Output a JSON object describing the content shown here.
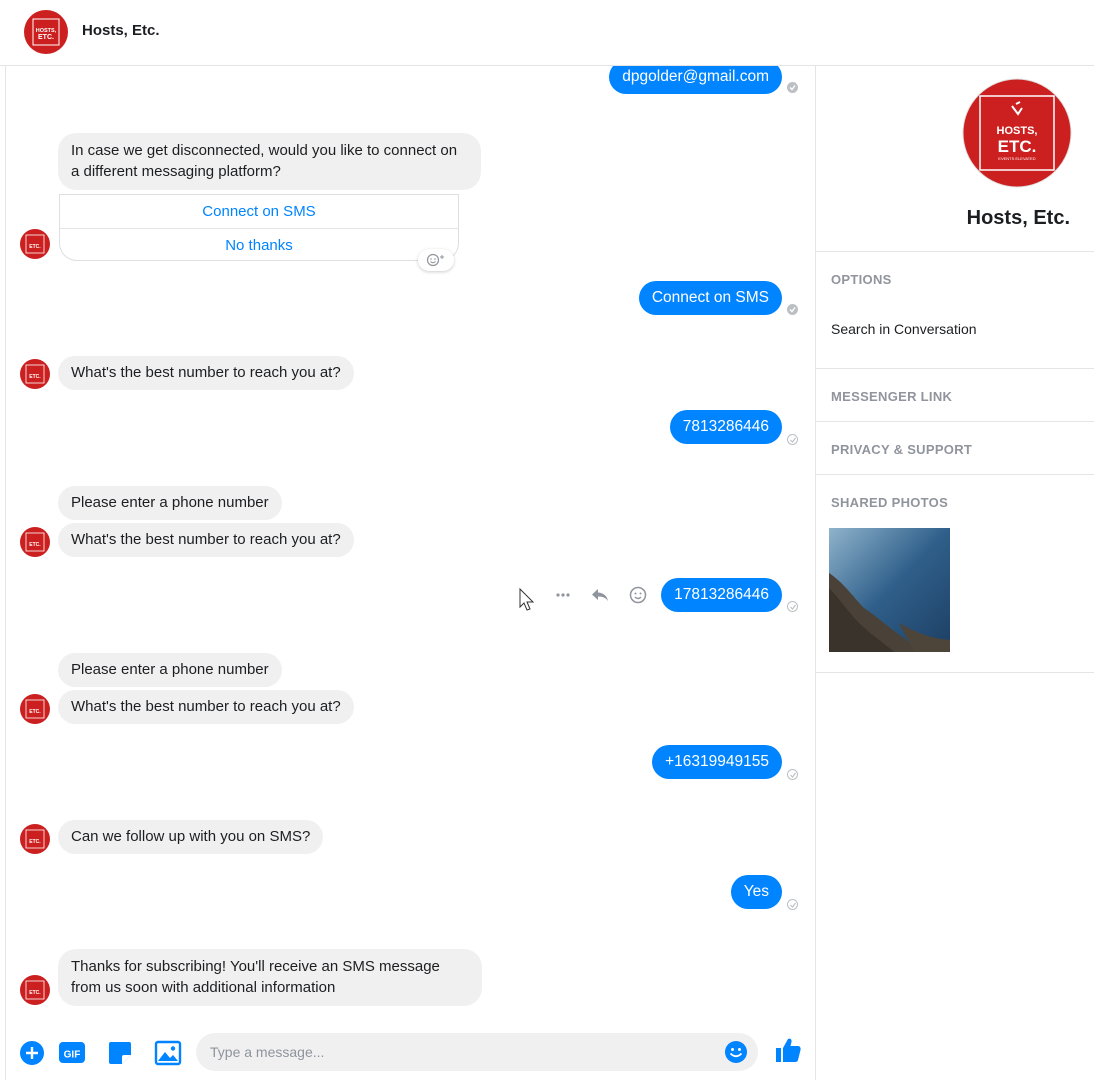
{
  "header": {
    "title": "Hosts, Etc."
  },
  "avatar": {
    "line1": "HOSTS,",
    "line2": "ETC.",
    "tagline": "EVENTS ELEVATED",
    "color": "#cc1f1f"
  },
  "messages": {
    "email": "dpgolder@gmail.com",
    "ask_platform": "In case we get disconnected, would you like to connect on a different messaging platform?",
    "quick_replies": [
      "Connect on SMS",
      "No thanks"
    ],
    "reply_sms": "Connect on SMS",
    "ask_number_1": "What's the best number to reach you at?",
    "number_1": "7813286446",
    "invalid_1": "Please enter a phone number",
    "ask_number_2": "What's the best number to reach you at?",
    "number_2": "17813286446",
    "invalid_2": "Please enter a phone number",
    "ask_number_3": "What's the best number to reach you at?",
    "number_3": "+16319949155",
    "ask_followup": "Can we follow up with you on SMS?",
    "reply_yes": "Yes",
    "thanks": "Thanks for subscribing! You'll receive an SMS message from us soon with additional information"
  },
  "composer": {
    "placeholder": "Type a message...",
    "gif_label": "GIF"
  },
  "sidebar": {
    "name": "Hosts, Etc.",
    "options_heading": "OPTIONS",
    "search_item": "Search in Conversation",
    "messenger_link": "MESSENGER LINK",
    "privacy_support": "PRIVACY & SUPPORT",
    "shared_photos": "SHARED PHOTOS"
  },
  "colors": {
    "accent": "#0084ff",
    "incoming": "#f1f0f0",
    "brand_red": "#cc1f1f"
  }
}
